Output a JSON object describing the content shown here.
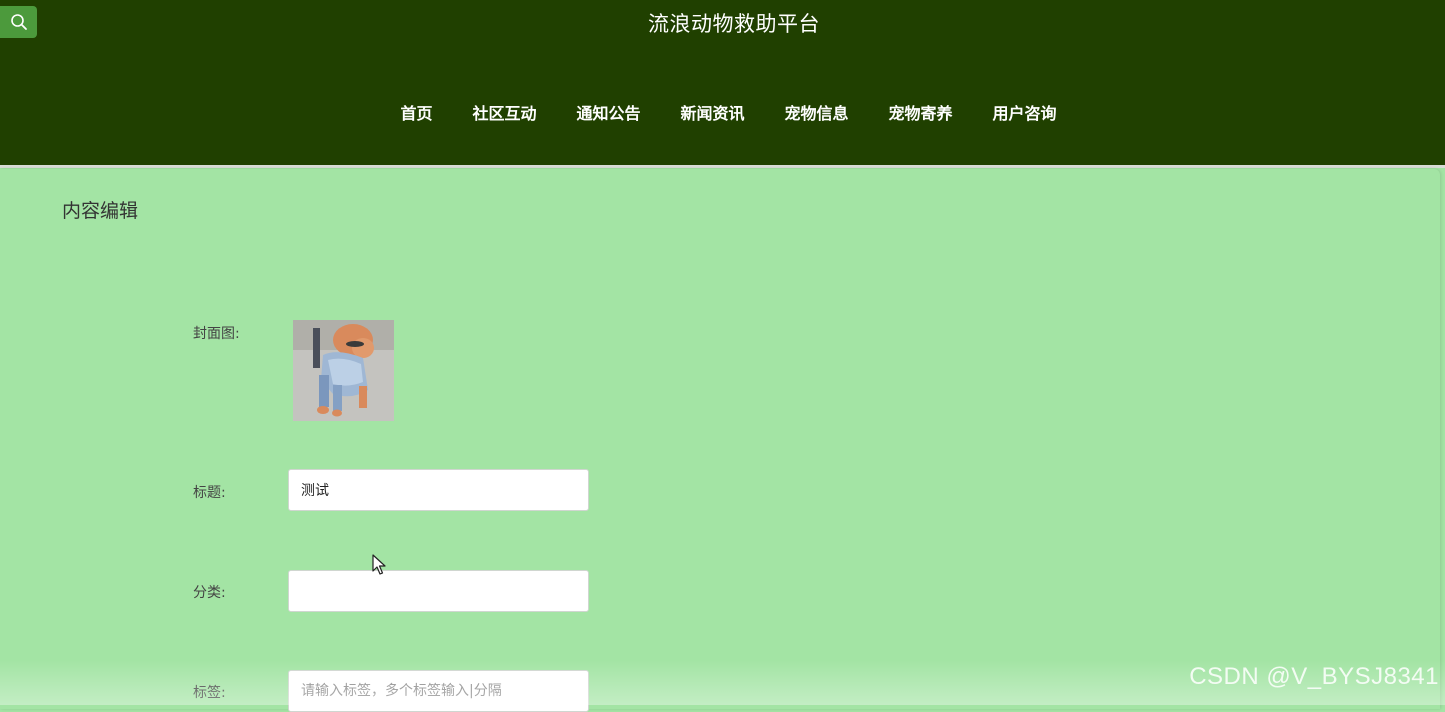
{
  "header": {
    "site_title": "流浪动物救助平台",
    "search_icon": "search-icon",
    "nav": [
      {
        "label": "首页"
      },
      {
        "label": "社区互动"
      },
      {
        "label": "通知公告"
      },
      {
        "label": "新闻资讯"
      },
      {
        "label": "宠物信息"
      },
      {
        "label": "宠物寄养"
      },
      {
        "label": "用户咨询"
      }
    ]
  },
  "form": {
    "panel_title": "内容编辑",
    "cover_label": "封面图:",
    "title_label": "标题:",
    "title_value": "测试",
    "category_label": "分类:",
    "category_value": "",
    "tags_label": "标签:",
    "tags_placeholder": "请输入标签，多个标签输入|分隔"
  },
  "watermark": "CSDN @V_BYSJ8341",
  "colors": {
    "header_bg": "#204000",
    "search_btn": "#4c9a3c",
    "page_bg": "#a3e4a4"
  }
}
